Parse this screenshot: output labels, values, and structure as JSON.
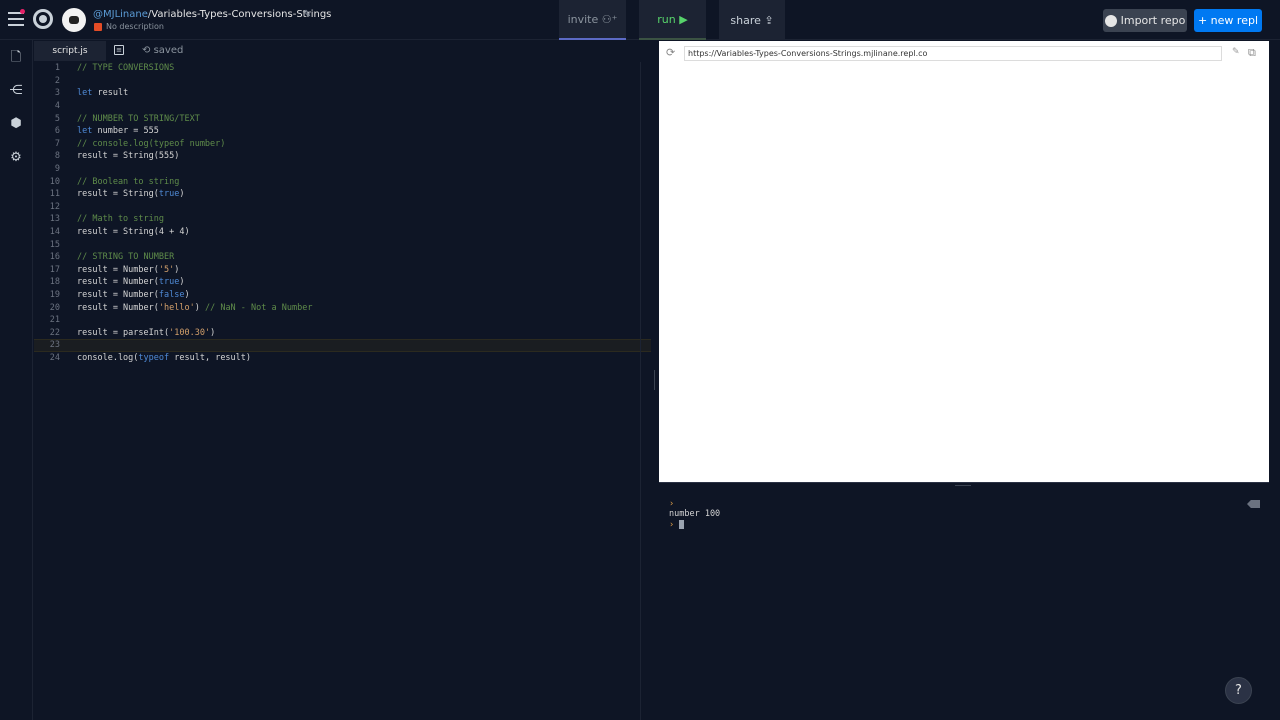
{
  "header": {
    "owner": "@MJLinane",
    "repl_name": "Variables-Types-Conversions-Strings",
    "description": "No description",
    "invite_label": "invite",
    "run_label": "run",
    "share_label": "share",
    "import_label": "Import repo",
    "new_repl_label": "+ new repl"
  },
  "editor": {
    "file_tab": "script.js",
    "save_status": "saved",
    "active_line": 23
  },
  "webview": {
    "url": "https://Variables-Types-Conversions-Strings.mjlinane.repl.co"
  },
  "console": {
    "output_line": "number 100"
  },
  "help_label": "?"
}
